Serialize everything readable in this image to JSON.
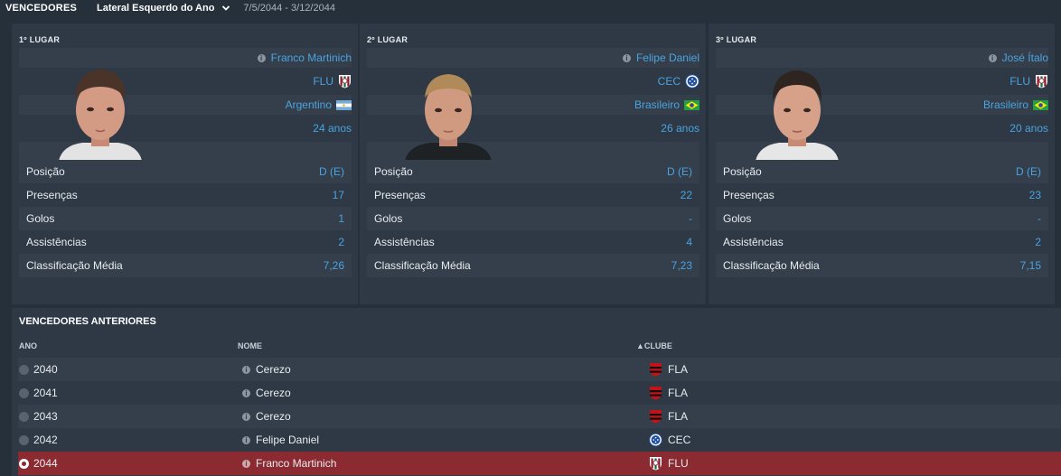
{
  "header": {
    "title": "VENCEDORES",
    "award": "Lateral Esquerdo do Ano",
    "dates": "7/5/2044 - 3/12/2044"
  },
  "cards": [
    {
      "rank": "1º LUGAR",
      "name": "Franco Martinich",
      "club": "FLU",
      "nationality": "Argentino",
      "age": "24 anos",
      "stats": [
        {
          "label": "Posição",
          "value": "D (E)"
        },
        {
          "label": "Presenças",
          "value": "17"
        },
        {
          "label": "Golos",
          "value": "1"
        },
        {
          "label": "Assistências",
          "value": "2"
        },
        {
          "label": "Classificação Média",
          "value": "7,26"
        }
      ]
    },
    {
      "rank": "2º LUGAR",
      "name": "Felipe Daniel",
      "club": "CEC",
      "nationality": "Brasileiro",
      "age": "26 anos",
      "stats": [
        {
          "label": "Posição",
          "value": "D (E)"
        },
        {
          "label": "Presenças",
          "value": "22"
        },
        {
          "label": "Golos",
          "value": "-"
        },
        {
          "label": "Assistências",
          "value": "4"
        },
        {
          "label": "Classificação Média",
          "value": "7,23"
        }
      ]
    },
    {
      "rank": "3º LUGAR",
      "name": "José Ítalo",
      "club": "FLU",
      "nationality": "Brasileiro",
      "age": "20 anos",
      "stats": [
        {
          "label": "Posição",
          "value": "D (E)"
        },
        {
          "label": "Presenças",
          "value": "23"
        },
        {
          "label": "Golos",
          "value": "-"
        },
        {
          "label": "Assistências",
          "value": "2"
        },
        {
          "label": "Classificação Média",
          "value": "7,15"
        }
      ]
    }
  ],
  "previous": {
    "title": "VENCEDORES ANTERIORES",
    "columns": {
      "year": "ANO",
      "name": "NOME",
      "club": "▲CLUBE"
    },
    "rows": [
      {
        "year": "2040",
        "name": "Cerezo",
        "club": "FLA",
        "selected": false
      },
      {
        "year": "2041",
        "name": "Cerezo",
        "club": "FLA",
        "selected": false
      },
      {
        "year": "2043",
        "name": "Cerezo",
        "club": "FLA",
        "selected": false
      },
      {
        "year": "2042",
        "name": "Felipe Daniel",
        "club": "CEC",
        "selected": false
      },
      {
        "year": "2044",
        "name": "Franco Martinich",
        "club": "FLU",
        "selected": true
      }
    ]
  },
  "colors": {
    "background": "#26303a",
    "panel": "#2e3945",
    "accent": "#4aa3df",
    "selected_row": "#8b2b31"
  },
  "icons": {
    "info": "info-icon",
    "dropdown": "chevron-down-icon",
    "crest_flu": "flu-crest-icon",
    "crest_cec": "cec-crest-icon",
    "crest_fla": "fla-crest-icon",
    "flag_argentina": "argentina-flag-icon",
    "flag_brazil": "brazil-flag-icon"
  }
}
